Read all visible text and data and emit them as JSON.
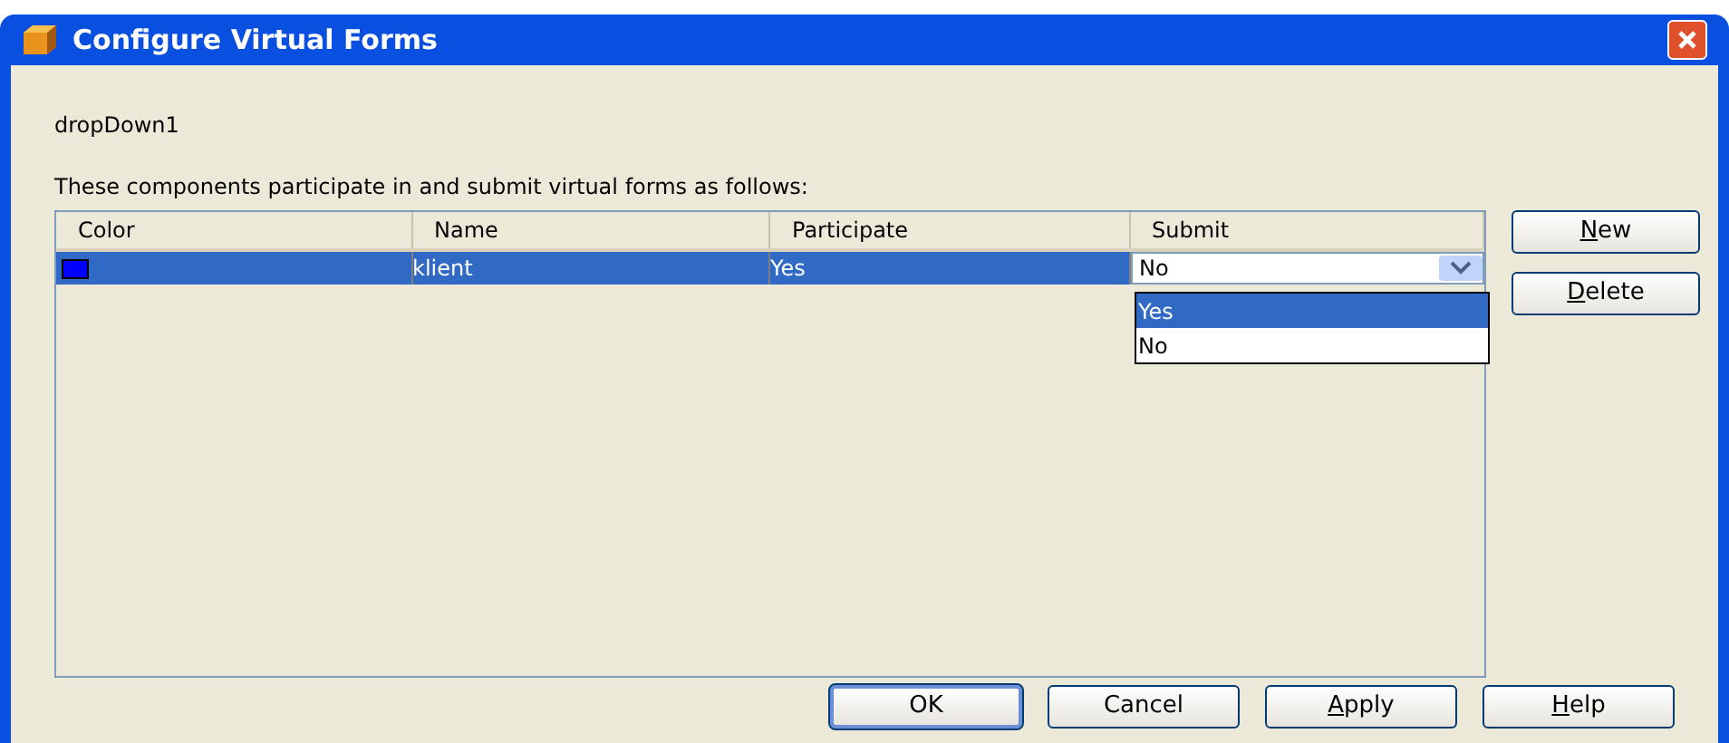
{
  "window": {
    "title": "Configure Virtual Forms"
  },
  "component": "dropDown1",
  "description": "These components participate in and submit virtual forms as follows:",
  "table": {
    "columns": [
      "Color",
      "Name",
      "Participate",
      "Submit"
    ],
    "rows": [
      {
        "color": "#0000ff",
        "name": "klient",
        "participate": "Yes",
        "submit": "No",
        "selected": true
      }
    ]
  },
  "dropdown": {
    "expanded": true,
    "options": [
      {
        "label": "Yes",
        "selected": true
      },
      {
        "label": "No",
        "selected": false
      }
    ]
  },
  "side_buttons": [
    {
      "label": "New",
      "mnemonic": true
    },
    {
      "label": "Delete",
      "mnemonic": true
    }
  ],
  "buttons": [
    {
      "label": "OK",
      "mnemonic": false,
      "default": true
    },
    {
      "label": "Cancel",
      "mnemonic": false,
      "default": false
    },
    {
      "label": "Apply",
      "mnemonic": true,
      "default": false
    },
    {
      "label": "Help",
      "mnemonic": true,
      "default": false
    }
  ]
}
